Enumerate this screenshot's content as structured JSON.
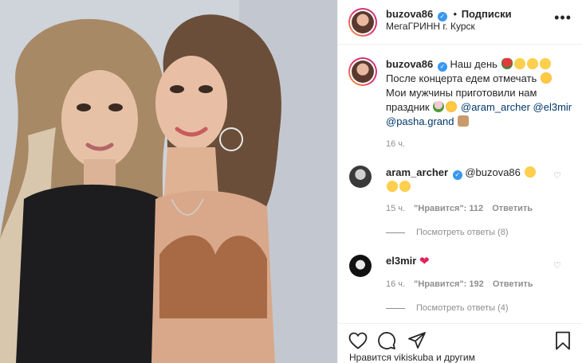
{
  "post": {
    "username": "buzova86",
    "separator": "•",
    "follow_label": "Подписки",
    "location": "МегаГРИНН г. Курск",
    "more_icon": "ellipsis-icon"
  },
  "caption": {
    "username": "buzova86",
    "text_1": "Наш день",
    "text_2": "После концерта едем отмечать",
    "text_3": "Мои мужчины приготовили нам праздник",
    "mention_1": "@aram_archer",
    "mention_2": "@el3mir",
    "mention_3": "@pasha.grand",
    "time": "16 ч."
  },
  "comments": [
    {
      "username": "aram_archer",
      "text": "@buzova86",
      "time": "15 ч.",
      "likes": "\"Нравится\": 112",
      "reply_label": "Ответить",
      "view_replies": "Посмотреть ответы (8)"
    },
    {
      "username": "el3mir",
      "text": "",
      "time": "16 ч.",
      "likes": "\"Нравится\": 192",
      "reply_label": "Ответить",
      "view_replies": "Посмотреть ответы (4)"
    }
  ],
  "footer": {
    "likes_text": "Нравится vikiskuba и другим"
  },
  "colors": {
    "link": "#00376b",
    "muted": "#8e8e8e",
    "verified": "#3897f0",
    "heart": "#e0245e"
  }
}
